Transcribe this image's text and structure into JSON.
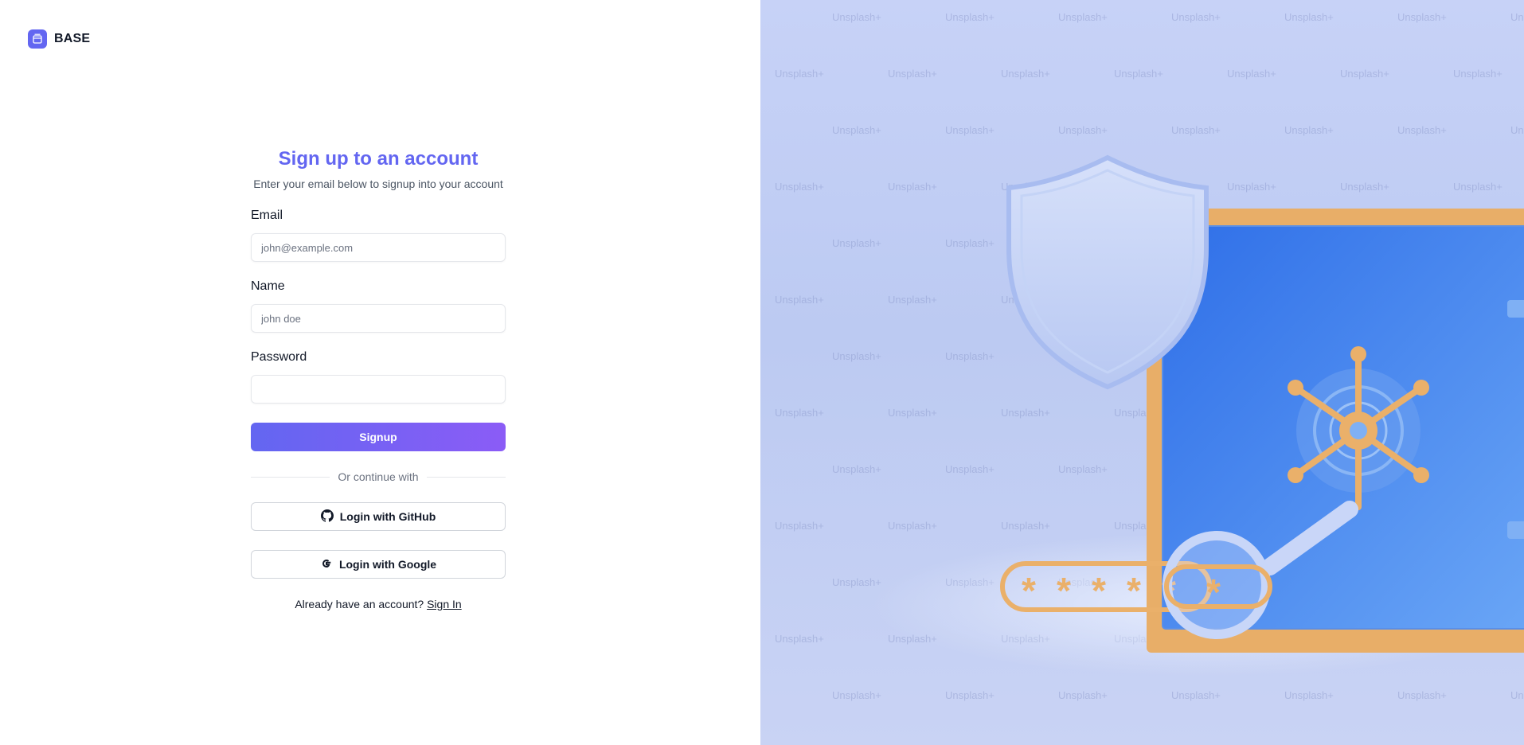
{
  "brand": {
    "name": "BASE",
    "icon": "stack-icon",
    "accent": "#6366f1"
  },
  "form": {
    "title": "Sign up to an account",
    "subtitle": "Enter your email below to signup into your account",
    "fields": {
      "email": {
        "label": "Email",
        "placeholder": "john@example.com",
        "value": ""
      },
      "name": {
        "label": "Name",
        "placeholder": "john doe",
        "value": ""
      },
      "password": {
        "label": "Password",
        "placeholder": "",
        "value": ""
      }
    },
    "submit_label": "Signup",
    "divider_text": "Or continue with",
    "github": {
      "label": "Login with GitHub",
      "icon": "github-icon"
    },
    "google": {
      "label": "Login with Google",
      "icon": "google-icon"
    },
    "footer": {
      "prompt": "Already have an account?",
      "link_label": "Sign In"
    }
  },
  "illustration": {
    "watermark": "Unsplash+",
    "colors": {
      "safe": "#4f8ff2",
      "frame": "#e9b06a",
      "shield": "#c9d6f5",
      "background": "#c7d2f7"
    }
  }
}
